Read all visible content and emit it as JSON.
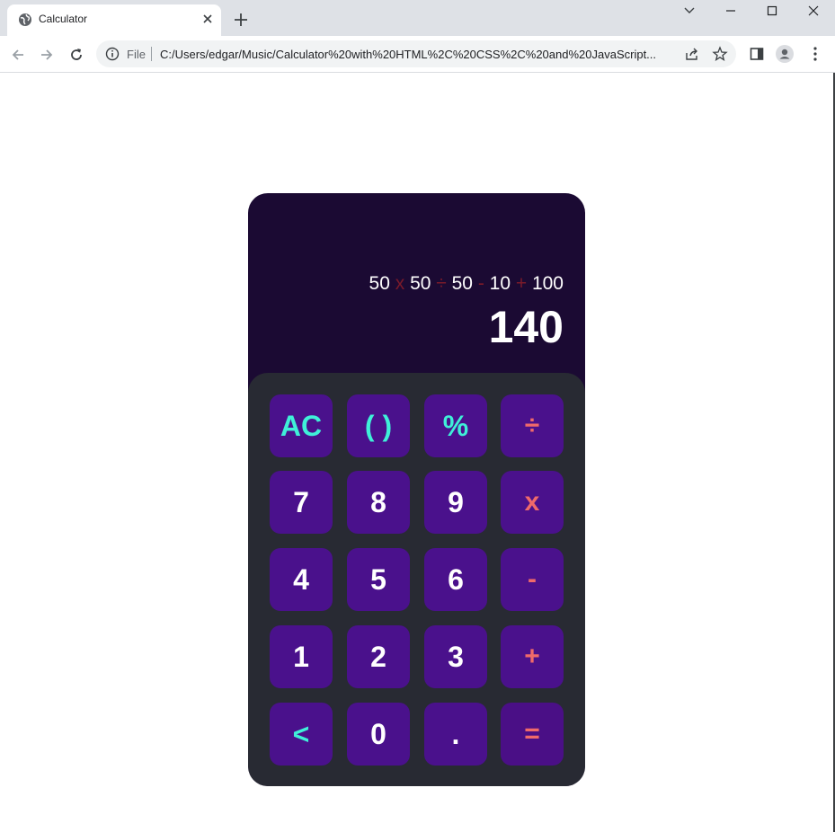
{
  "browser": {
    "tab_title": "Calculator",
    "omnibox_scheme_label": "File",
    "url": "C:/Users/edgar/Music/Calculator%20with%20HTML%2C%20CSS%2C%20and%20JavaScript..."
  },
  "calculator": {
    "expression": [
      {
        "text": "50",
        "kind": "number"
      },
      {
        "text": " x ",
        "kind": "operator"
      },
      {
        "text": "50",
        "kind": "number"
      },
      {
        "text": " ÷ ",
        "kind": "operator"
      },
      {
        "text": "50",
        "kind": "number"
      },
      {
        "text": " - ",
        "kind": "operator"
      },
      {
        "text": "10",
        "kind": "number"
      },
      {
        "text": " + ",
        "kind": "operator"
      },
      {
        "text": "100",
        "kind": "number"
      }
    ],
    "result": "140",
    "keys": [
      {
        "label": "AC",
        "kind": "function",
        "name": "clear-button"
      },
      {
        "label": "( )",
        "kind": "function",
        "name": "parentheses-button"
      },
      {
        "label": "%",
        "kind": "function",
        "name": "percent-button"
      },
      {
        "label": "÷",
        "kind": "operator",
        "name": "divide-button"
      },
      {
        "label": "7",
        "kind": "number",
        "name": "digit-7-button"
      },
      {
        "label": "8",
        "kind": "number",
        "name": "digit-8-button"
      },
      {
        "label": "9",
        "kind": "number",
        "name": "digit-9-button"
      },
      {
        "label": "x",
        "kind": "operator",
        "name": "multiply-button"
      },
      {
        "label": "4",
        "kind": "number",
        "name": "digit-4-button"
      },
      {
        "label": "5",
        "kind": "number",
        "name": "digit-5-button"
      },
      {
        "label": "6",
        "kind": "number",
        "name": "digit-6-button"
      },
      {
        "label": "-",
        "kind": "operator",
        "name": "subtract-button"
      },
      {
        "label": "1",
        "kind": "number",
        "name": "digit-1-button"
      },
      {
        "label": "2",
        "kind": "number",
        "name": "digit-2-button"
      },
      {
        "label": "3",
        "kind": "number",
        "name": "digit-3-button"
      },
      {
        "label": "+",
        "kind": "operator",
        "name": "add-button"
      },
      {
        "label": "<",
        "kind": "function",
        "name": "backspace-button"
      },
      {
        "label": "0",
        "kind": "number",
        "name": "digit-0-button"
      },
      {
        "label": ".",
        "kind": "number",
        "name": "decimal-button"
      },
      {
        "label": "=",
        "kind": "operator",
        "name": "equals-button"
      }
    ],
    "colors": {
      "display_bg": "#1b0a33",
      "keypad_bg": "#282a33",
      "key_bg": "#4a118c",
      "number_text": "#ffffff",
      "function_text": "#3ff0d8",
      "operator_text": "#f06a6a"
    }
  }
}
